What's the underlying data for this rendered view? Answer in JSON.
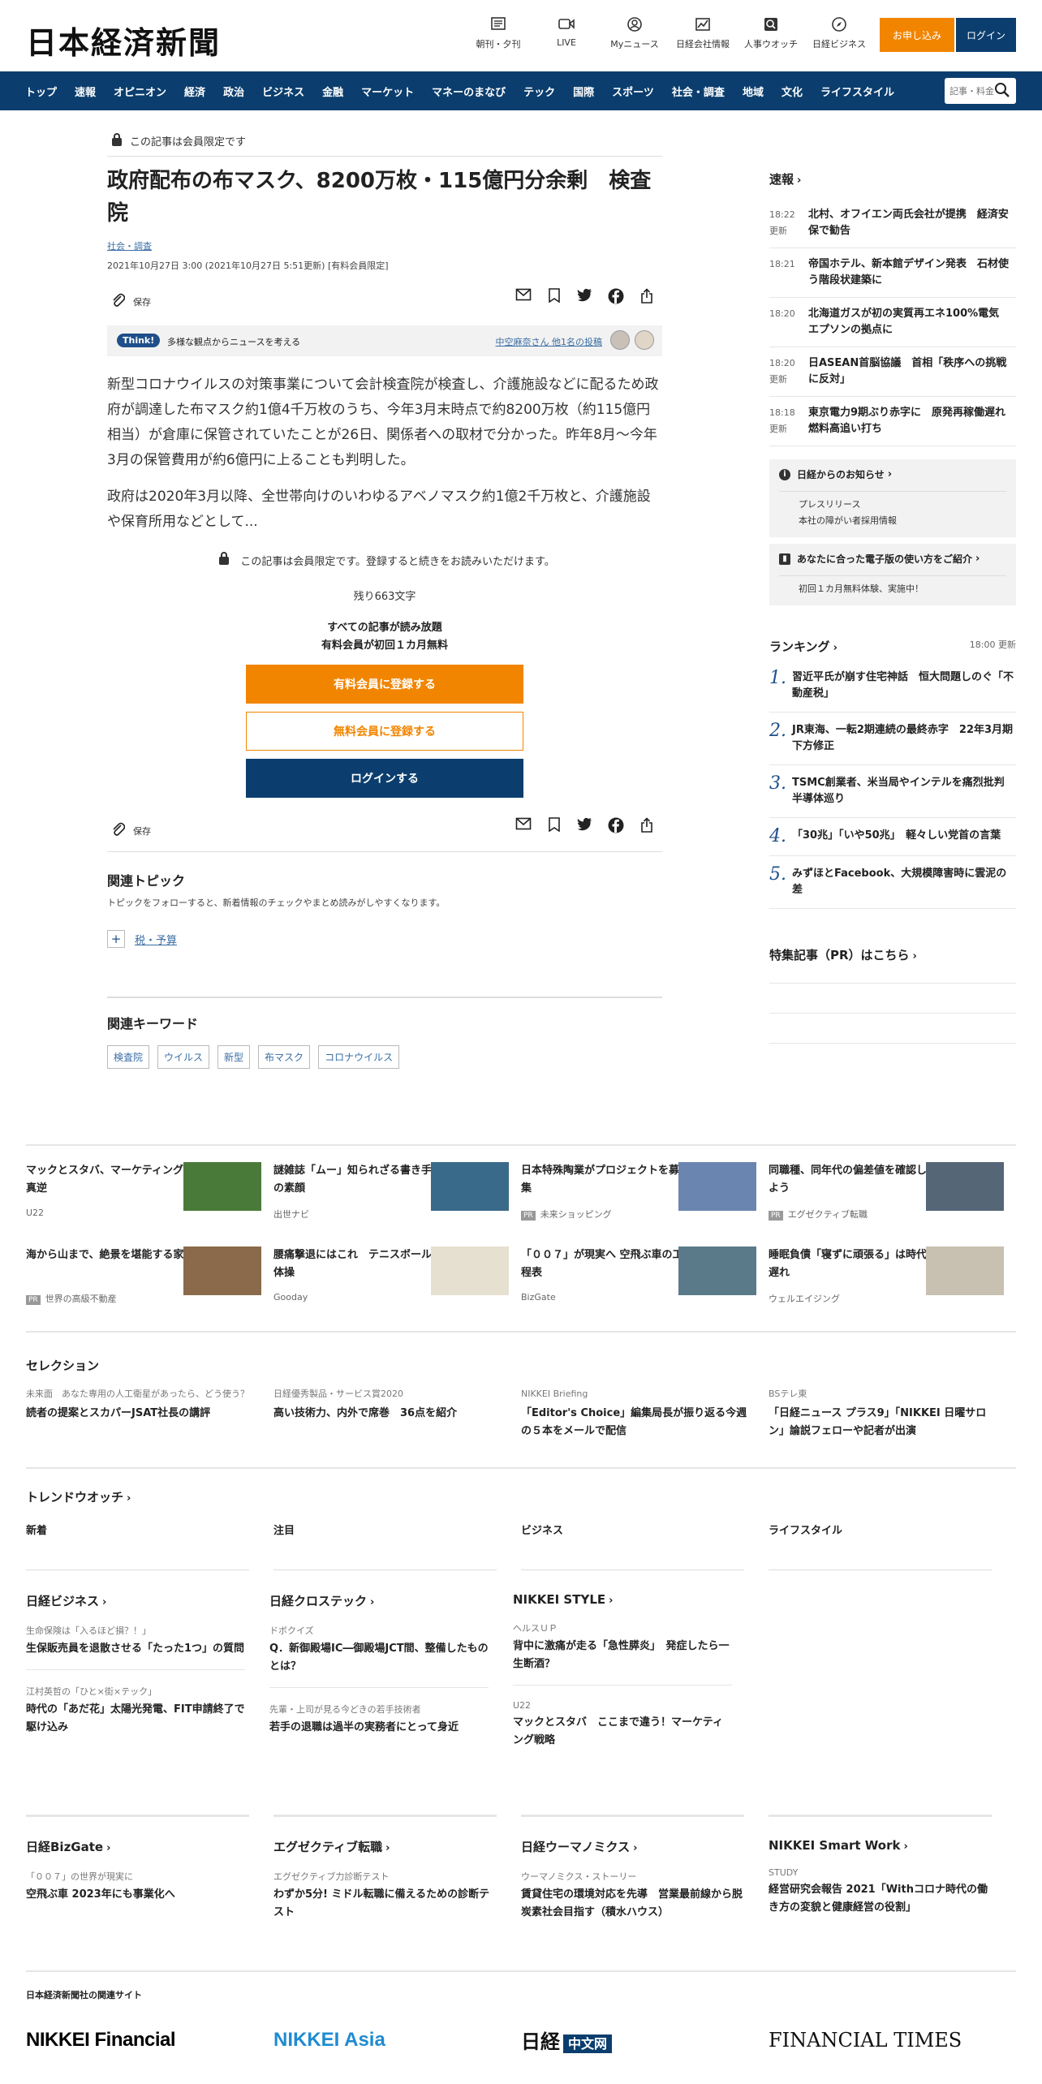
{
  "header": {
    "logo": "日本経済新聞",
    "icons": [
      {
        "name": "newspaper-icon",
        "label": "朝刊・夕刊"
      },
      {
        "name": "video-icon",
        "label": "LIVE"
      },
      {
        "name": "person-icon",
        "label": "Myニュース"
      },
      {
        "name": "chart-icon",
        "label": "日経会社情報"
      },
      {
        "name": "search-person-icon",
        "label": "人事ウオッチ"
      },
      {
        "name": "compass-icon",
        "label": "日経ビジネス"
      }
    ],
    "apply_label": "お申し込み",
    "login_label": "ログイン"
  },
  "nav": {
    "items": [
      "トップ",
      "速報",
      "オピニオン",
      "経済",
      "政治",
      "ビジネス",
      "金融",
      "マーケット",
      "マネーのまなび",
      "テック",
      "国際",
      "スポーツ",
      "社会・調査",
      "地域",
      "文化",
      "ライフスタイル"
    ],
    "search_placeholder": "記事・料金"
  },
  "article": {
    "member_label": "この記事は会員限定です",
    "title": "政府配布の布マスク、8200万枚・115億円分余剰　検査院",
    "category": "社会・調査",
    "date": "2021年10月27日 3:00 (2021年10月27日 5:51更新) [有料会員限定]",
    "save_label": "保存",
    "think_badge": "Think!",
    "think_text": "多様な観点からニュースを考える",
    "think_link": "中空麻奈さん 他1名の投稿",
    "paragraph1": "新型コロナウイルスの対策事業について会計検査院が検査し、介護施設などに配るため政府が調達した布マスク約1億4千万枚のうち、今年3月末時点で約8200万枚（約115億円相当）が倉庫に保管されていたことが26日、関係者への取材で分かった。昨年8月～今年3月の保管費用が約6億円に上ることも判明した。",
    "paragraph2": "政府は2020年3月以降、全世帯向けのいわゆるアベノマスク約1億2千万枚と、介護施設や保育所用などとして...",
    "locked_note": "この記事は会員限定です。登録すると続きをお読みいただけます。",
    "remaining": "残り663文字",
    "allread_1": "すべての記事が読み放題",
    "allread_2": "有料会員が初回１カ月無料",
    "cta_paid": "有料会員に登録する",
    "cta_free": "無料会員に登録する",
    "cta_login": "ログインする",
    "related_topic_h": "関連トピック",
    "related_topic_d": "トピックをフォローすると、新着情報のチェックやまとめ読みがしやすくなります。",
    "topic": "税・予算",
    "keywords_h": "関連キーワード",
    "keywords": [
      "検査院",
      "ウイルス",
      "新型",
      "布マスク",
      "コロナウイルス"
    ]
  },
  "sidebar": {
    "sokuho_h": "速報",
    "sokuho": [
      {
        "time": "18:22",
        "upd": "更新",
        "text": "北村、オフイエン両氏会社が提携　経済安保で勧告"
      },
      {
        "time": "18:21",
        "upd": "",
        "text": "帝国ホテル、新本館デザイン発表　石材使う階段状建築に"
      },
      {
        "time": "18:20",
        "upd": "",
        "text": "北海道ガスが初の実質再エネ100%電気　エプソンの拠点に"
      },
      {
        "time": "18:20",
        "upd": "更新",
        "text": "日ASEAN首脳協議　首相「秩序への挑戦に反対」"
      },
      {
        "time": "18:18",
        "upd": "更新",
        "text": "東京電力9期ぶり赤字に　原発再稼働遅れ燃料高追い打ち"
      }
    ],
    "info_h": "日経からのお知らせ",
    "info_items": [
      "プレスリリース",
      "本社の障がい者採用情報"
    ],
    "digital_h": "あなたに合った電子版の使い方をご紹介",
    "digital_items": [
      "初回１カ月無料体験、実施中！"
    ],
    "ranking_h": "ランキング",
    "ranking_time": "18:00 更新",
    "ranking": [
      {
        "num": "1.",
        "text": "習近平氏が崩す住宅神話　恒大問題しのぐ「不動産税」"
      },
      {
        "num": "2.",
        "text": "JR東海、一転2期連続の最終赤字　22年3月期下方修正"
      },
      {
        "num": "3.",
        "text": "TSMC創業者、米当局やインテルを痛烈批判　半導体巡り"
      },
      {
        "num": "4.",
        "text": "「30兆」「いや50兆」　軽々しい党首の言葉"
      },
      {
        "num": "5.",
        "text": "みずほとFacebook、大規模障害時に雲泥の差"
      }
    ],
    "pr_h": "特集記事（PR）はこちら"
  },
  "ads": [
    {
      "title": "マックとスタバ、マーケティング真逆",
      "source": "U22",
      "pr": false,
      "img_color": "#4a7a3a"
    },
    {
      "title": "謎雑誌「ムー」知られざる書き手の素顔",
      "source": "出世ナビ",
      "pr": false,
      "img_color": "#3a6a8a"
    },
    {
      "title": "日本特殊陶業がプロジェクトを募集",
      "source": "未来ショッピング",
      "pr": true,
      "img_color": "#6a86b0"
    },
    {
      "title": "同職種、同年代の偏差値を確認しよう",
      "source": "エグゼクティブ転職",
      "pr": true,
      "img_color": "#556677"
    },
    {
      "title": "海から山まで、絶景を堪能する家",
      "source": "世界の高級不動産",
      "pr": true,
      "img_color": "#8a6a4a"
    },
    {
      "title": "腰痛撃退にはこれ　テニスボール体操",
      "source": "Gooday",
      "pr": false,
      "img_color": "#e6e0d0"
    },
    {
      "title": "「００７」が現実へ 空飛ぶ車の工程表",
      "source": "BizGate",
      "pr": false,
      "img_color": "#5a7a8a"
    },
    {
      "title": "睡眠負債「寝ずに頑張る」は時代遅れ",
      "source": "ウェルエイジング",
      "pr": false,
      "img_color": "#c8c0b0"
    }
  ],
  "selection": {
    "h": "セレクション",
    "items": [
      {
        "k": "未来面　あなた専用の人工衛星があったら、どう使う？",
        "t": "読者の提案とスカパーJSAT社長の講評"
      },
      {
        "k": "日経優秀製品・サービス賞2020",
        "t": "高い技術力、内外で席巻　36点を紹介"
      },
      {
        "k": "NIKKEI Briefing",
        "t": "「Editor's Choice」編集局長が振り返る今週の５本をメールで配信"
      },
      {
        "k": "BSテレ東",
        "t": "「日経ニュース プラス9」「NIKKEI 日曜サロン」論説フェローや記者が出演"
      }
    ]
  },
  "trend": {
    "h": "トレンドウオッチ",
    "tabs": [
      "新着",
      "注目",
      "ビジネス",
      "ライフスタイル"
    ]
  },
  "media": [
    {
      "h": "日経ビジネス",
      "items": [
        {
          "k": "生命保険は「入るほど損？！」",
          "t": "生保販売員を退散させる「たった1つ」の質問"
        },
        {
          "k": "江村英哲の「ひと×街×テック」",
          "t": "時代の「あだ花」太陽光発電、FIT申請終了で駆け込み"
        }
      ]
    },
    {
      "h": "日経クロステック",
      "items": [
        {
          "k": "ドボクイズ",
          "t": "Q．新御殿場IC―御殿場JCT間、整備したものとは？"
        },
        {
          "k": "先輩・上司が見る今どきの若手技術者",
          "t": "若手の退職は過半の実務者にとって身近"
        }
      ]
    },
    {
      "h": "NIKKEI STYLE",
      "items": [
        {
          "k": "ヘルスＵＰ",
          "t": "背中に激痛が走る「急性膵炎」　発症したら一生断酒？"
        },
        {
          "k": "U22",
          "t": "マックとスタバ　ここまで違う！マーケティング戦略"
        }
      ]
    }
  ],
  "media2": [
    {
      "h": "日経BizGate",
      "k": "「００７」の世界が現実に",
      "t": "空飛ぶ車 2023年にも事業化へ"
    },
    {
      "h": "エグゼクティブ転職",
      "k": "エグゼクティブ力診断テスト",
      "t": "わずか5分! ミドル転職に備えるための診断テスト"
    },
    {
      "h": "日経ウーマノミクス",
      "k": "ウーマノミクス・ストーリー",
      "t": "賃貸住宅の環境対応を先導　営業最前線から脱炭素社会目指す（積水ハウス）"
    },
    {
      "h": "NIKKEI Smart Work",
      "k": "STUDY",
      "t": "経営研究会報告 2021「Withコロナ時代の働き方の変貌と健康経営の役割」"
    }
  ],
  "related": {
    "h": "日本経済新聞社の関連サイト",
    "logos": [
      "NIKKEI Financial",
      "NIKKEI Asia",
      "日経",
      "中文网",
      "FINANCIAL TIMES"
    ]
  }
}
